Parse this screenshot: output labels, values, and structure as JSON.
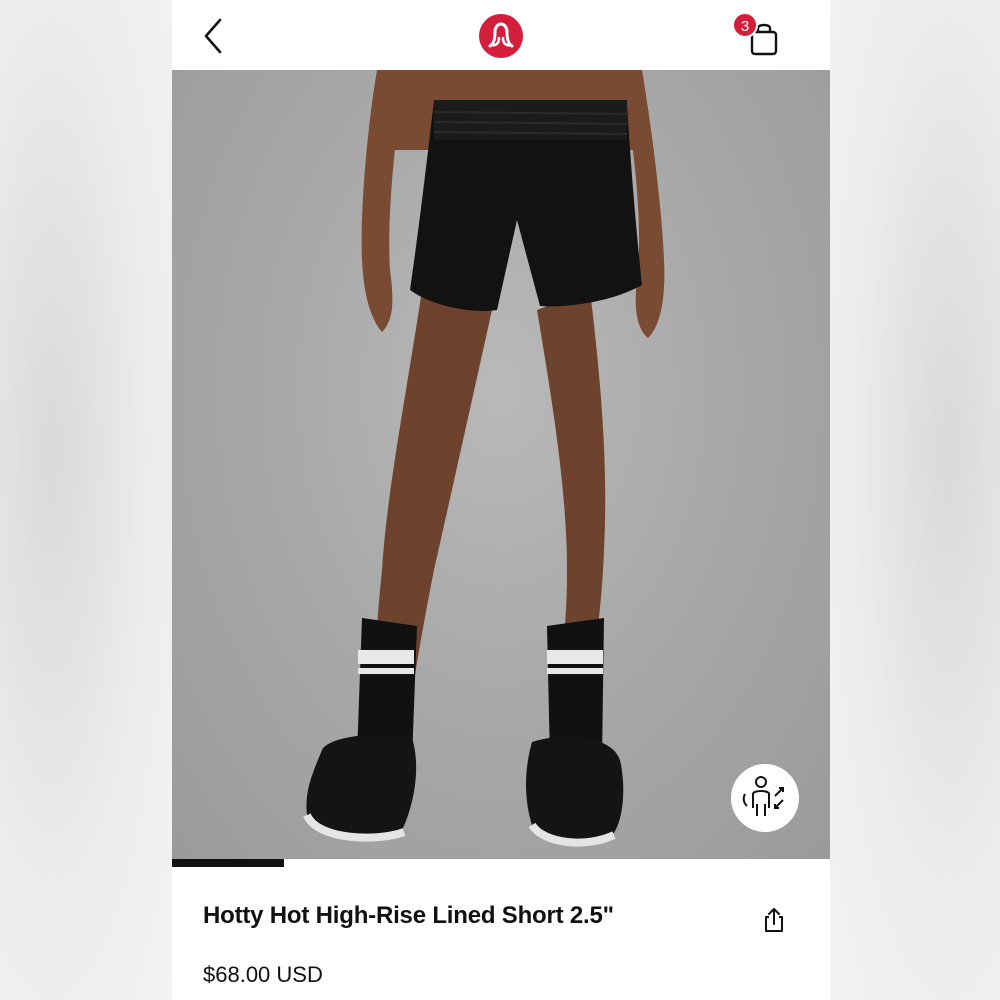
{
  "header": {
    "back_icon": "chevron-left-icon",
    "logo": "lululemon-logo",
    "bag_icon": "shopping-bag-icon",
    "bag_count": "3",
    "badge_color": "#d31f3c"
  },
  "gallery": {
    "image": "model wearing black high-rise shorts, black and white striped socks and black sneakers",
    "try_on_icon": "virtual-try-on-icon",
    "progress": 0.17
  },
  "product": {
    "title": "Hotty Hot High-Rise Lined Short 2.5\"",
    "price": "$68.00 USD",
    "share_icon": "share-icon"
  }
}
